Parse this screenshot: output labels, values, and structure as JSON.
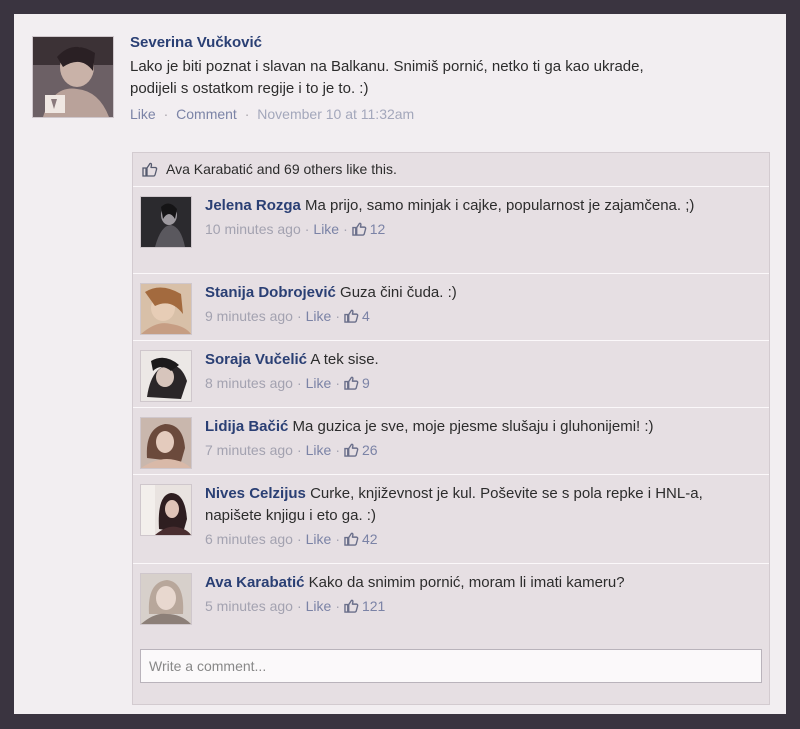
{
  "post": {
    "author": "Severina Vučković",
    "text_line1": "Lako je biti poznat i slavan na Balkanu. Snimiš pornić, netko ti ga kao ukrade,",
    "text_line2": "podijeli s ostatkom regije i to je to. :)",
    "like_label": "Like",
    "comment_label": "Comment",
    "timestamp": "November 10 at 11:32am",
    "separator": "·"
  },
  "likes_summary": "Ava Karabatić and 69 others like this.",
  "comments": [
    {
      "author": "Jelena Rozga",
      "text": "Ma prijo, samo minjak i cajke, popularnost je zajamčena. ;)",
      "time": "10 minutes ago",
      "like": "Like",
      "likes": "12"
    },
    {
      "author": "Stanija Dobrojević",
      "text": "Guza čini čuda. :)",
      "time": "9 minutes ago",
      "like": "Like",
      "likes": "4"
    },
    {
      "author": "Soraja Vučelić",
      "text": "A tek sise.",
      "time": "8 minutes ago",
      "like": "Like",
      "likes": "9"
    },
    {
      "author": "Lidija Bačić",
      "text": "Ma guzica je sve, moje pjesme slušaju i gluhonijemi! :)",
      "time": "7 minutes ago",
      "like": "Like",
      "likes": "26"
    },
    {
      "author": "Nives Celzijus",
      "text": "Curke, književnost je kul. Poševite se s pola repke i HNL-a, napišete knjigu i eto ga. :)",
      "time": "6 minutes ago",
      "like": "Like",
      "likes": "42"
    },
    {
      "author": "Ava Karabatić",
      "text": "Kako da snimim pornić, moram li imati kameru?",
      "time": "5 minutes ago",
      "like": "Like",
      "likes": "121"
    }
  ],
  "comment_input": {
    "placeholder": "Write a comment..."
  },
  "icons": {
    "thumb": "thumbs-up-icon",
    "avatar": "profile-photo"
  },
  "colors": {
    "name_link": "#2a3f74",
    "action_link": "#7b83a6",
    "timestamp": "#a3a7bb"
  }
}
